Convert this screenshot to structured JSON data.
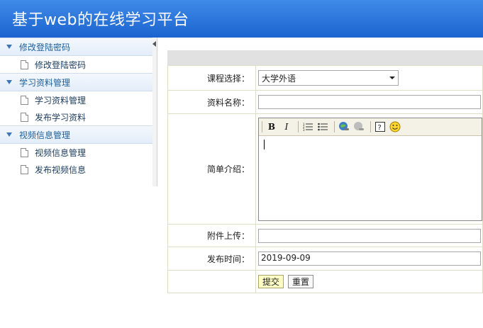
{
  "header": {
    "title": "基于web的在线学习平台"
  },
  "sidebar": {
    "sections": [
      {
        "title": "修改登陆密码",
        "items": [
          "修改登陆密码"
        ]
      },
      {
        "title": "学习资料管理",
        "items": [
          "学习资料管理",
          "发布学习资料"
        ]
      },
      {
        "title": "视频信息管理",
        "items": [
          "视频信息管理",
          "发布视频信息"
        ]
      }
    ]
  },
  "form": {
    "course_label": "课程选择：",
    "course_value": "大学外语",
    "name_label": "资料名称：",
    "name_value": "",
    "intro_label": "简单介绍：",
    "attachment_label": "附件上传：",
    "attachment_value": "",
    "date_label": "发布时间：",
    "date_value": "2019-09-09",
    "submit_label": "提交",
    "reset_label": "重置"
  },
  "editor_toolbar": {
    "bold": "B",
    "italic": "I",
    "icons": [
      "bold-icon",
      "italic-icon",
      "ordered-list-icon",
      "unordered-list-icon",
      "link-icon",
      "unlink-icon",
      "help-icon",
      "smiley-icon"
    ]
  },
  "colors": {
    "header": "#2a72dc",
    "section_text": "#1d5f9a",
    "submit_bg": "#ffffc6"
  }
}
